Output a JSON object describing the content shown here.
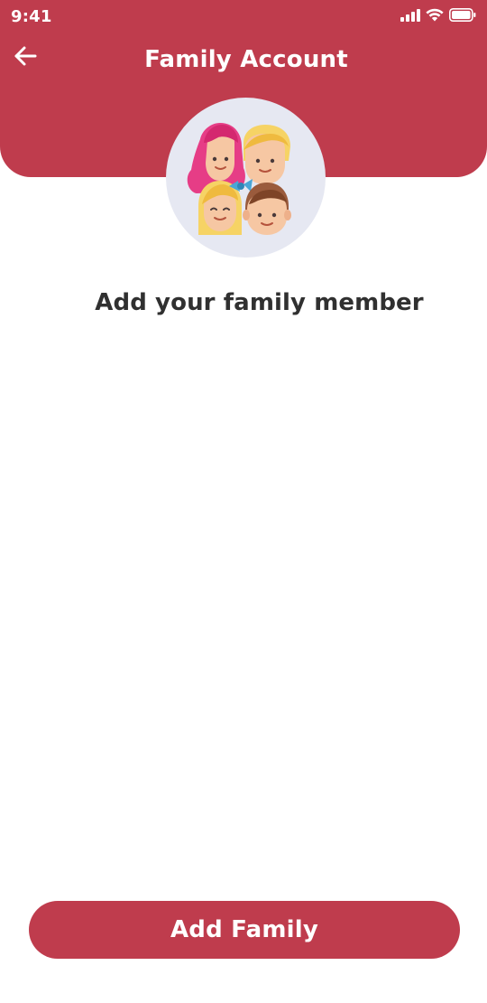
{
  "status_bar": {
    "time": "9:41",
    "icons": [
      "signal-icon",
      "wifi-icon",
      "battery-icon"
    ]
  },
  "header": {
    "title": "Family Account",
    "back_icon": "arrow-left-icon"
  },
  "avatar": {
    "icon": "family-group-illustration"
  },
  "main": {
    "subtitle": "Add your family member"
  },
  "footer": {
    "button_label": "Add Family"
  },
  "colors": {
    "brand": "#bf3c4d",
    "avatar_bg": "#e6e8f2",
    "text": "#2f2f2f"
  }
}
